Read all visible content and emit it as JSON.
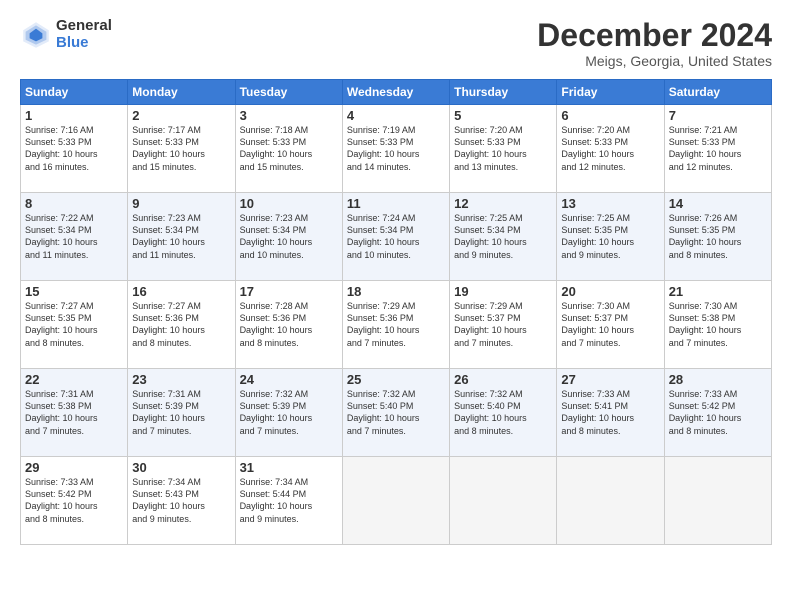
{
  "logo": {
    "general": "General",
    "blue": "Blue"
  },
  "title": "December 2024",
  "location": "Meigs, Georgia, United States",
  "days_of_week": [
    "Sunday",
    "Monday",
    "Tuesday",
    "Wednesday",
    "Thursday",
    "Friday",
    "Saturday"
  ],
  "weeks": [
    [
      {
        "day": "1",
        "info": "Sunrise: 7:16 AM\nSunset: 5:33 PM\nDaylight: 10 hours\nand 16 minutes."
      },
      {
        "day": "2",
        "info": "Sunrise: 7:17 AM\nSunset: 5:33 PM\nDaylight: 10 hours\nand 15 minutes."
      },
      {
        "day": "3",
        "info": "Sunrise: 7:18 AM\nSunset: 5:33 PM\nDaylight: 10 hours\nand 15 minutes."
      },
      {
        "day": "4",
        "info": "Sunrise: 7:19 AM\nSunset: 5:33 PM\nDaylight: 10 hours\nand 14 minutes."
      },
      {
        "day": "5",
        "info": "Sunrise: 7:20 AM\nSunset: 5:33 PM\nDaylight: 10 hours\nand 13 minutes."
      },
      {
        "day": "6",
        "info": "Sunrise: 7:20 AM\nSunset: 5:33 PM\nDaylight: 10 hours\nand 12 minutes."
      },
      {
        "day": "7",
        "info": "Sunrise: 7:21 AM\nSunset: 5:33 PM\nDaylight: 10 hours\nand 12 minutes."
      }
    ],
    [
      {
        "day": "8",
        "info": "Sunrise: 7:22 AM\nSunset: 5:34 PM\nDaylight: 10 hours\nand 11 minutes."
      },
      {
        "day": "9",
        "info": "Sunrise: 7:23 AM\nSunset: 5:34 PM\nDaylight: 10 hours\nand 11 minutes."
      },
      {
        "day": "10",
        "info": "Sunrise: 7:23 AM\nSunset: 5:34 PM\nDaylight: 10 hours\nand 10 minutes."
      },
      {
        "day": "11",
        "info": "Sunrise: 7:24 AM\nSunset: 5:34 PM\nDaylight: 10 hours\nand 10 minutes."
      },
      {
        "day": "12",
        "info": "Sunrise: 7:25 AM\nSunset: 5:34 PM\nDaylight: 10 hours\nand 9 minutes."
      },
      {
        "day": "13",
        "info": "Sunrise: 7:25 AM\nSunset: 5:35 PM\nDaylight: 10 hours\nand 9 minutes."
      },
      {
        "day": "14",
        "info": "Sunrise: 7:26 AM\nSunset: 5:35 PM\nDaylight: 10 hours\nand 8 minutes."
      }
    ],
    [
      {
        "day": "15",
        "info": "Sunrise: 7:27 AM\nSunset: 5:35 PM\nDaylight: 10 hours\nand 8 minutes."
      },
      {
        "day": "16",
        "info": "Sunrise: 7:27 AM\nSunset: 5:36 PM\nDaylight: 10 hours\nand 8 minutes."
      },
      {
        "day": "17",
        "info": "Sunrise: 7:28 AM\nSunset: 5:36 PM\nDaylight: 10 hours\nand 8 minutes."
      },
      {
        "day": "18",
        "info": "Sunrise: 7:29 AM\nSunset: 5:36 PM\nDaylight: 10 hours\nand 7 minutes."
      },
      {
        "day": "19",
        "info": "Sunrise: 7:29 AM\nSunset: 5:37 PM\nDaylight: 10 hours\nand 7 minutes."
      },
      {
        "day": "20",
        "info": "Sunrise: 7:30 AM\nSunset: 5:37 PM\nDaylight: 10 hours\nand 7 minutes."
      },
      {
        "day": "21",
        "info": "Sunrise: 7:30 AM\nSunset: 5:38 PM\nDaylight: 10 hours\nand 7 minutes."
      }
    ],
    [
      {
        "day": "22",
        "info": "Sunrise: 7:31 AM\nSunset: 5:38 PM\nDaylight: 10 hours\nand 7 minutes."
      },
      {
        "day": "23",
        "info": "Sunrise: 7:31 AM\nSunset: 5:39 PM\nDaylight: 10 hours\nand 7 minutes."
      },
      {
        "day": "24",
        "info": "Sunrise: 7:32 AM\nSunset: 5:39 PM\nDaylight: 10 hours\nand 7 minutes."
      },
      {
        "day": "25",
        "info": "Sunrise: 7:32 AM\nSunset: 5:40 PM\nDaylight: 10 hours\nand 7 minutes."
      },
      {
        "day": "26",
        "info": "Sunrise: 7:32 AM\nSunset: 5:40 PM\nDaylight: 10 hours\nand 8 minutes."
      },
      {
        "day": "27",
        "info": "Sunrise: 7:33 AM\nSunset: 5:41 PM\nDaylight: 10 hours\nand 8 minutes."
      },
      {
        "day": "28",
        "info": "Sunrise: 7:33 AM\nSunset: 5:42 PM\nDaylight: 10 hours\nand 8 minutes."
      }
    ],
    [
      {
        "day": "29",
        "info": "Sunrise: 7:33 AM\nSunset: 5:42 PM\nDaylight: 10 hours\nand 8 minutes."
      },
      {
        "day": "30",
        "info": "Sunrise: 7:34 AM\nSunset: 5:43 PM\nDaylight: 10 hours\nand 9 minutes."
      },
      {
        "day": "31",
        "info": "Sunrise: 7:34 AM\nSunset: 5:44 PM\nDaylight: 10 hours\nand 9 minutes."
      },
      null,
      null,
      null,
      null
    ]
  ]
}
